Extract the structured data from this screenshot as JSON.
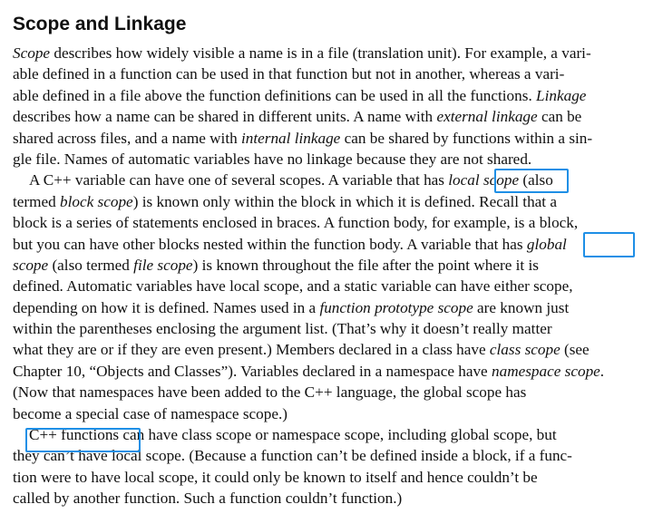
{
  "section": {
    "title": "Scope and Linkage"
  },
  "lines": [
    [
      "",
      "Scope",
      " describes how widely visible a name is in a file (translation unit). For example, a vari-"
    ],
    [
      "able defined in a function can be used in that function but not in another, whereas a vari-"
    ],
    [
      "able defined in a file above the function definitions can be used in all the functions. ",
      "Linkage"
    ],
    [
      "describes how a name can be shared in different units. A name with ",
      "external linkage",
      " can be"
    ],
    [
      "shared across files, and a name with ",
      "internal linkage",
      " can be shared by functions within a sin-"
    ],
    [
      "gle file. Names of automatic variables have no linkage because they are not shared."
    ],
    [
      "A C++ variable can have one of several scopes. A variable that has ",
      "local scope",
      " (also"
    ],
    [
      "termed ",
      "block scope",
      ") is known only within the block in which it is defined. Recall that a"
    ],
    [
      "block is a series of statements enclosed in braces. A function body, for example, is a block,"
    ],
    [
      "but you can have other blocks nested within the function body. A variable that has ",
      "global"
    ],
    [
      "",
      "scope",
      " (also termed ",
      "file scope",
      ") is known throughout the file after the point where it is"
    ],
    [
      "defined. Automatic variables have local scope, and a static variable can have either scope,"
    ],
    [
      "depending on how it is defined. Names used in a ",
      "function prototype scope",
      " are known just"
    ],
    [
      "within the parentheses enclosing the argument list. (That’s why it doesn’t really matter"
    ],
    [
      "what they are or if they are even present.) Members declared in a class have ",
      "class scope",
      " (see"
    ],
    [
      "Chapter 10, “Objects and Classes”). Variables declared in a namespace have ",
      "namespace scope",
      "."
    ],
    [
      "(Now that namespaces have been added to the C++ language, the global scope has"
    ],
    [
      "become a special case of namespace scope.)"
    ],
    [
      "C++ functions can have class scope or namespace scope, including global scope, but"
    ],
    [
      "they can’t have local scope. (Because a function can’t be defined inside a block, if a func-"
    ],
    [
      "tion were to have local scope, it could only be known to itself and hence couldn’t be"
    ],
    [
      "called by another function. Such a function couldn’t function.)"
    ]
  ],
  "highlight_color": "#1e8fe6"
}
